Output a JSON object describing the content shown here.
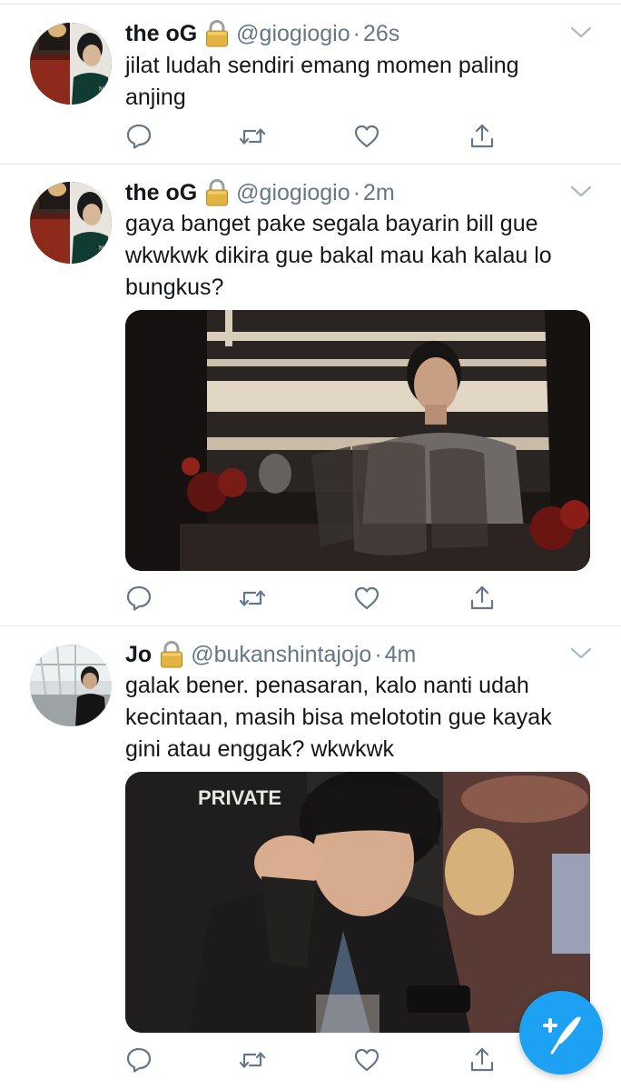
{
  "tweets": [
    {
      "name": "the oG",
      "handle": "@giogiogio",
      "time": "26s",
      "lines": [
        "jilat ludah sendiri emang momen paling",
        "anjing"
      ]
    },
    {
      "name": "the oG",
      "handle": "@giogiogio",
      "time": "2m",
      "lines": [
        "gaya banget pake segala bayarin bill gue",
        "wkwkwk dikira gue bakal mau kah kalau lo",
        "bungkus?"
      ]
    },
    {
      "name": "Jo",
      "handle": "@bukanshintajojo",
      "time": "4m",
      "lines": [
        "galak bener. penasaran, kalo nanti udah",
        "kecintaan, masih bisa melototin gue kayak",
        "gini atau enggak? wkwkwk"
      ],
      "photo_sign": "PRIVATE"
    }
  ],
  "separator": "·",
  "icons": {
    "lock": "padlock-icon",
    "caret": "chevron-down-icon",
    "reply": "reply-icon",
    "retweet": "retweet-icon",
    "like": "heart-icon",
    "share": "share-icon",
    "compose": "compose-tweet-icon"
  },
  "colors": {
    "accent": "#1da1f2",
    "text": "#14171a",
    "secondary": "#657786",
    "divider": "#e1e8ed"
  }
}
